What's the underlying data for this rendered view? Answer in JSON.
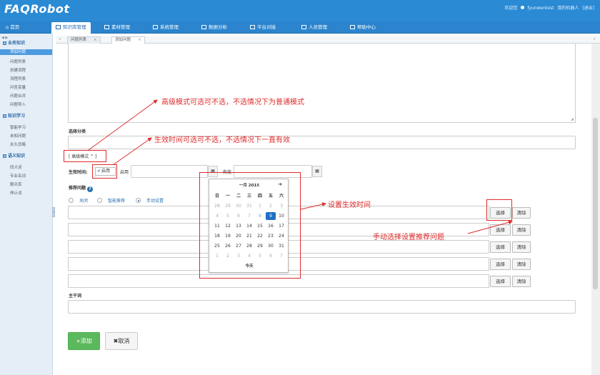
{
  "header": {
    "logo": "FAQRobot",
    "welcome": "欢迎您",
    "username": "fyunwentest",
    "my_robot": "我的机器人",
    "logout": "[退出]"
  },
  "nav": {
    "home": "首页",
    "knowledge": "知识库管理",
    "material": "素材管理",
    "system": "系统管理",
    "analytics": "数据分析",
    "platform": "平台对接",
    "personnel": "人员管理",
    "help": "帮助中心"
  },
  "sidebar": {
    "groups": [
      {
        "label": "业务知识",
        "items": [
          "添加问题",
          "问题列表",
          "创建流程",
          "流程列表",
          "问答变量",
          "问题合并",
          "问题导入"
        ]
      },
      {
        "label": "知识学习",
        "items": [
          "智能学习",
          "未知问题",
          "永久忽略"
        ]
      },
      {
        "label": "语义知识",
        "items": [
          "同义词",
          "专业名词",
          "聊天库",
          "停止词"
        ]
      }
    ],
    "active_item": "添加问题"
  },
  "subtabs": [
    {
      "label": "问题列表",
      "close": "×"
    },
    {
      "label": "添加问题",
      "close": "×"
    }
  ],
  "form": {
    "category_label": "选择分类",
    "advanced_label": "[ 高级模式 ^ ]",
    "effective_time_label": "生效时间:",
    "enable_label": "启用",
    "enable_checked": true,
    "start_label": "启用",
    "end_label": "失效",
    "recommend_label": "推荐问题",
    "radio_options": [
      "关闭",
      "智能推荐",
      "手动设置"
    ],
    "radio_selected": "手动设置",
    "select_label": "选择",
    "clear_label": "清除",
    "keyword_label": "主干词",
    "add_button": "+添加",
    "cancel_button": "✖取消"
  },
  "calendar": {
    "title": "一月 2015",
    "next": "➔",
    "weekdays": [
      "日",
      "一",
      "二",
      "三",
      "四",
      "五",
      "六"
    ],
    "weeks": [
      [
        "28",
        "29",
        "30",
        "31",
        "1",
        "2",
        "3"
      ],
      [
        "4",
        "5",
        "6",
        "7",
        "8",
        "9",
        "10"
      ],
      [
        "11",
        "12",
        "13",
        "14",
        "15",
        "16",
        "17"
      ],
      [
        "18",
        "19",
        "20",
        "21",
        "22",
        "23",
        "24"
      ],
      [
        "25",
        "26",
        "27",
        "28",
        "29",
        "30",
        "31"
      ],
      [
        "1",
        "2",
        "3",
        "4",
        "5",
        "6",
        "7"
      ]
    ],
    "today_label": "今天",
    "selected": "9"
  },
  "annotations": {
    "advanced_mode": "高级模式可选可不选，不选情况下为普通模式",
    "effective_time": "生效时间可选可不选，不选情况下一直有效",
    "set_time": "设置生效时间",
    "manual_select": "手动选择设置推荐问题"
  },
  "colors": {
    "header_bg": "#2a8ad4",
    "annotation_red": "#e02b2b",
    "add_green": "#5cb85c",
    "calendar_today": "#1f6fc5"
  }
}
